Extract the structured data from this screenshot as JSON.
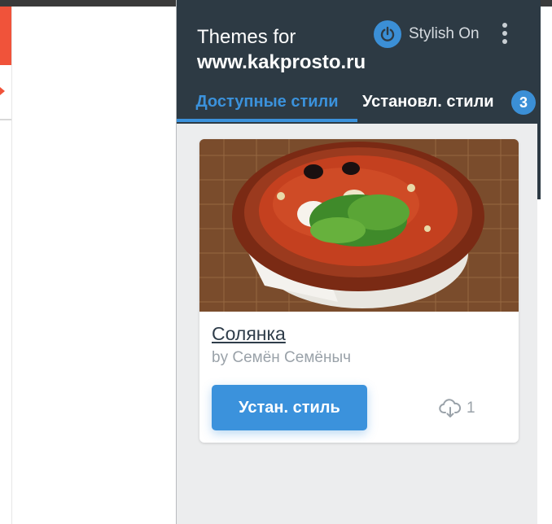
{
  "popup": {
    "title_prefix": "Themes for",
    "site": "www.kakprosto.ru",
    "power_icon": "power-icon",
    "status_label": "Stylish On",
    "menu_icon": "kebab-menu-icon",
    "tabs": [
      {
        "label": "Доступные стили",
        "active": true
      },
      {
        "label": "Установл. стили",
        "active": false,
        "badge": "3"
      }
    ],
    "accent_color": "#3b92dc",
    "header_color": "#2d3a44"
  },
  "card": {
    "image_desc": "soup-photo",
    "title": "Солянка",
    "author": "by Семён Семёныч",
    "install_label": "Устан. стиль",
    "download_icon": "cloud-download-icon",
    "downloads": "1"
  }
}
